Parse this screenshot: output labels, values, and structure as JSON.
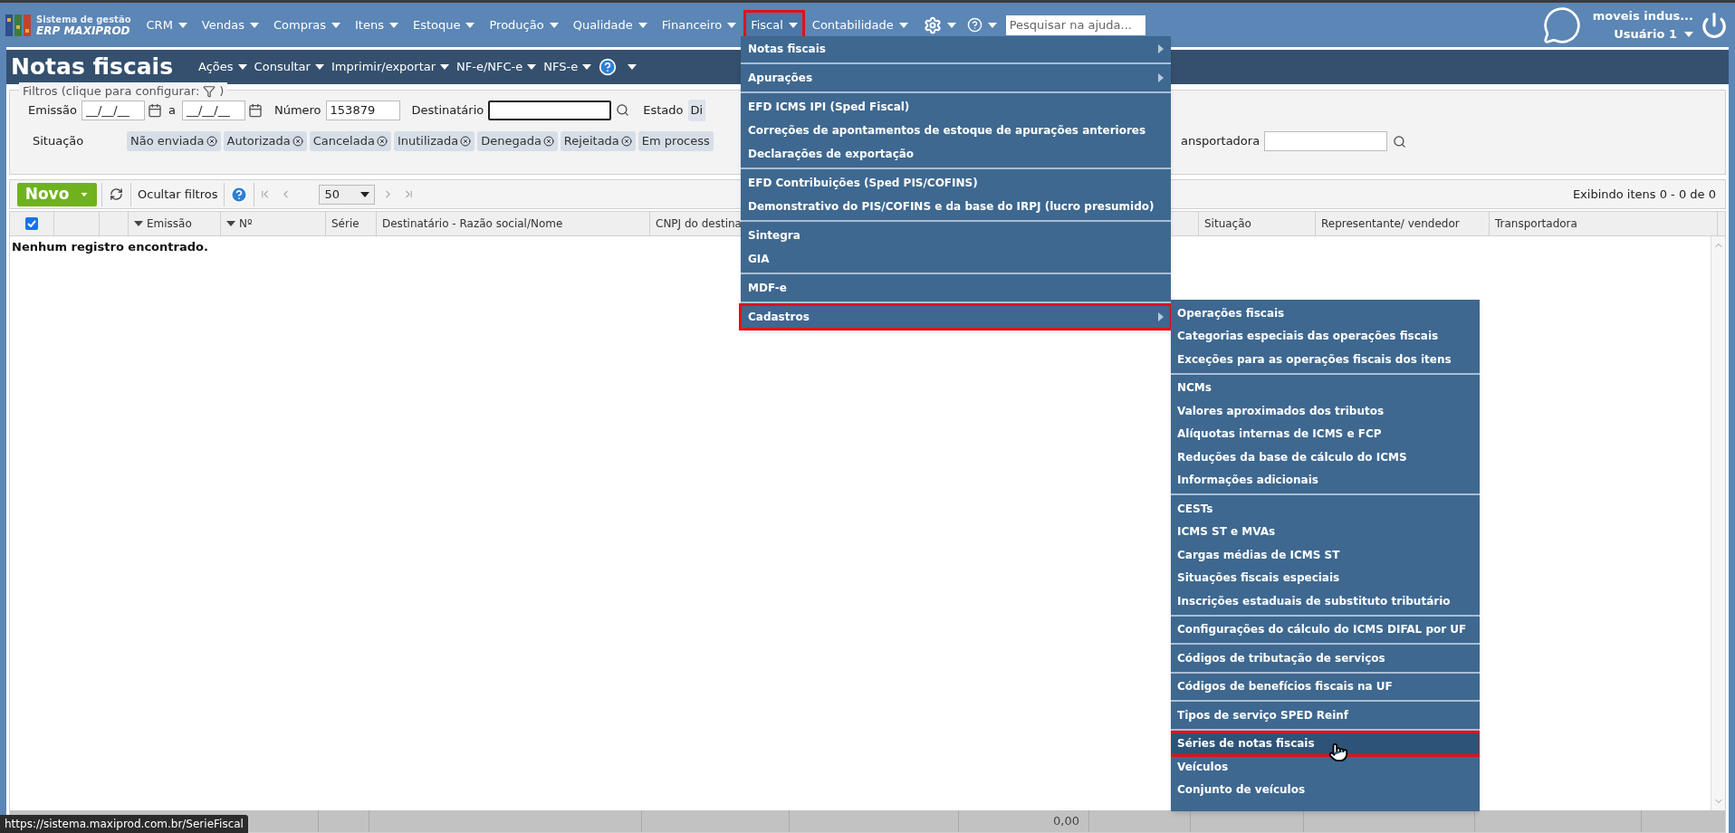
{
  "top_nav": {
    "logo": {
      "line1": "Sistema de gestão",
      "line2": "ERP MAXIPROD"
    },
    "menus": [
      {
        "label": "CRM",
        "highlighted": false
      },
      {
        "label": "Vendas",
        "highlighted": false
      },
      {
        "label": "Compras",
        "highlighted": false
      },
      {
        "label": "Itens",
        "highlighted": false
      },
      {
        "label": "Estoque",
        "highlighted": false
      },
      {
        "label": "Produção",
        "highlighted": false
      },
      {
        "label": "Qualidade",
        "highlighted": false
      },
      {
        "label": "Financeiro",
        "highlighted": false
      },
      {
        "label": "Fiscal",
        "highlighted": true
      },
      {
        "label": "Contabilidade",
        "highlighted": false
      }
    ],
    "icon_menus": [
      {
        "kind": "settings"
      },
      {
        "kind": "help"
      }
    ],
    "search": {
      "placeholder": "Pesquisar na ajuda..."
    },
    "user": {
      "company": "moveis indus...",
      "name": "Usuário 1"
    }
  },
  "page": {
    "title": "Notas fiscais",
    "menus": [
      "Ações",
      "Consultar",
      "Imprimir/exportar",
      "NF-e/NFC-e",
      "NFS-e"
    ]
  },
  "filters": {
    "legend_start": "Filtros (clique para configurar:",
    "legend_end": ")",
    "emissao_label": "Emissão",
    "date_from": "__/__/__",
    "between": "a",
    "date_to": "__/__/__",
    "numero_label": "Número",
    "numero": "153879",
    "destinatario_label": "Destinatário",
    "estado_label": "Estado",
    "estado": "Di",
    "situacao_label": "Situação",
    "situacao_tags": [
      "Não enviada",
      "Autorizada",
      "Cancelada",
      "Inutilizada",
      "Denegada",
      "Rejeitada",
      "Em process"
    ],
    "transportadora_label": "ansportadora"
  },
  "toolbar": {
    "new_button": "Novo",
    "hide_filters": "Ocultar filtros",
    "page_size": "50",
    "summary": "Exibindo itens 0 - 0 de 0"
  },
  "table": {
    "select_all_checked": true,
    "columns": [
      {
        "kind": "blank"
      },
      {
        "kind": "blank"
      },
      {
        "kind": "text",
        "label": "Emissão",
        "sorted": true
      },
      {
        "kind": "text",
        "label": "Nº",
        "sorted": true
      },
      {
        "kind": "text",
        "label": "Série",
        "sorted": false
      },
      {
        "kind": "text",
        "label": "Destinatário - Razão social/Nome",
        "sorted": false
      },
      {
        "kind": "text",
        "label": "CNPJ do destina",
        "sorted": false
      },
      {
        "kind": "text",
        "label": "Situação",
        "sorted": false
      },
      {
        "kind": "text",
        "label": "Representante/ vendedor",
        "sorted": false
      },
      {
        "kind": "text",
        "label": "Transportadora",
        "sorted": false
      }
    ],
    "empty_message": "Nenhum registro encontrado.",
    "total": "0,00"
  },
  "status_url": "https://sistema.maxiprod.com.br/SerieFiscal",
  "fiscal_menu": {
    "groups": [
      [
        {
          "label": "Notas fiscais",
          "has_submenu": true,
          "highlighted": false
        }
      ],
      [
        {
          "label": "Apurações",
          "has_submenu": true,
          "highlighted": false
        }
      ],
      [
        {
          "label": "EFD ICMS IPI (Sped Fiscal)",
          "has_submenu": false,
          "highlighted": false
        },
        {
          "label": "Correções de apontamentos de estoque de apurações anteriores",
          "has_submenu": false,
          "highlighted": false
        },
        {
          "label": "Declarações de exportação",
          "has_submenu": false,
          "highlighted": false
        }
      ],
      [
        {
          "label": "EFD Contribuições (Sped PIS/COFINS)",
          "has_submenu": false,
          "highlighted": false
        },
        {
          "label": "Demonstrativo do PIS/COFINS e da base do IRPJ (lucro presumido)",
          "has_submenu": false,
          "highlighted": false
        }
      ],
      [
        {
          "label": "Sintegra",
          "has_submenu": false,
          "highlighted": false
        },
        {
          "label": "GIA",
          "has_submenu": false,
          "highlighted": false
        }
      ],
      [
        {
          "label": "MDF-e",
          "has_submenu": false,
          "highlighted": false
        }
      ],
      [
        {
          "label": "Cadastros",
          "has_submenu": true,
          "highlighted": true
        }
      ]
    ]
  },
  "cadastros_submenu": {
    "groups": [
      [
        {
          "label": "Operações fiscais",
          "selected": false,
          "highlighted": false
        },
        {
          "label": "Categorias especiais das operações fiscais",
          "selected": false,
          "highlighted": false
        },
        {
          "label": "Exceções para as operações fiscais dos itens",
          "selected": false,
          "highlighted": false
        }
      ],
      [
        {
          "label": "NCMs",
          "selected": false,
          "highlighted": false
        },
        {
          "label": "Valores aproximados dos tributos",
          "selected": false,
          "highlighted": false
        },
        {
          "label": "Alíquotas internas de ICMS e FCP",
          "selected": false,
          "highlighted": false
        },
        {
          "label": "Reduções da base de cálculo do ICMS",
          "selected": false,
          "highlighted": false
        },
        {
          "label": "Informações adicionais",
          "selected": false,
          "highlighted": false
        }
      ],
      [
        {
          "label": "CESTs",
          "selected": false,
          "highlighted": false
        },
        {
          "label": "ICMS ST e MVAs",
          "selected": false,
          "highlighted": false
        },
        {
          "label": "Cargas médias de ICMS ST",
          "selected": false,
          "highlighted": false
        },
        {
          "label": "Situações fiscais especiais",
          "selected": false,
          "highlighted": false
        },
        {
          "label": "Inscrições estaduais de substituto tributário",
          "selected": false,
          "highlighted": false
        }
      ],
      [
        {
          "label": "Configurações do cálculo do ICMS DIFAL por UF",
          "selected": false,
          "highlighted": false
        }
      ],
      [
        {
          "label": "Códigos de tributação de serviços",
          "selected": false,
          "highlighted": false
        }
      ],
      [
        {
          "label": "Códigos de benefícios fiscais na UF",
          "selected": false,
          "highlighted": false
        }
      ],
      [
        {
          "label": "Tipos de serviço SPED Reinf",
          "selected": false,
          "highlighted": false
        }
      ],
      [
        {
          "label": "Séries de notas fiscais",
          "selected": true,
          "highlighted": true
        },
        {
          "label": "Veículos",
          "selected": false,
          "highlighted": false
        },
        {
          "label": "Conjunto de veículos",
          "selected": false,
          "highlighted": false
        }
      ]
    ]
  }
}
